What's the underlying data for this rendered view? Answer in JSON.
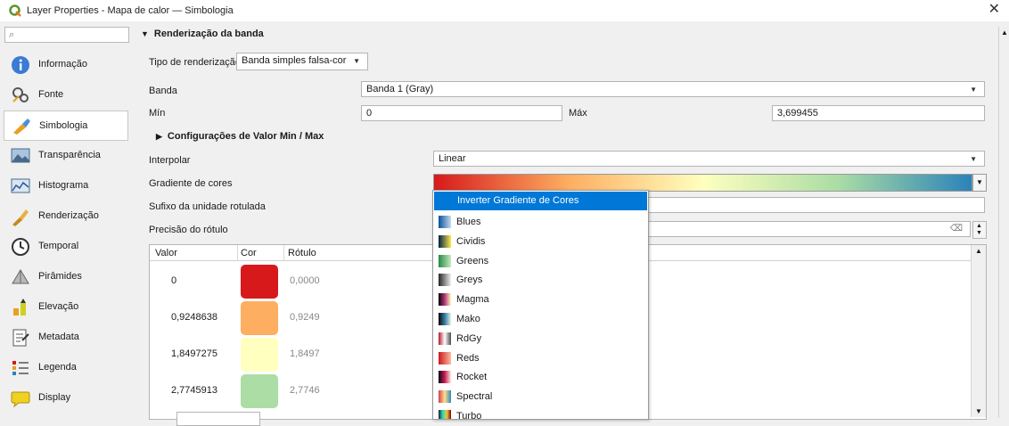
{
  "window": {
    "title": "Layer Properties - Mapa de calor — Simbologia",
    "close_glyph": "✕"
  },
  "sidebar": {
    "search_icon": "⌕",
    "items": [
      {
        "label": "Informação",
        "icon": "info-icon"
      },
      {
        "label": "Fonte",
        "icon": "source-icon"
      },
      {
        "label": "Simbologia",
        "icon": "symbology-icon",
        "active": true
      },
      {
        "label": "Transparência",
        "icon": "transparency-icon"
      },
      {
        "label": "Histograma",
        "icon": "histogram-icon"
      },
      {
        "label": "Renderização",
        "icon": "rendering-icon"
      },
      {
        "label": "Temporal",
        "icon": "clock-icon"
      },
      {
        "label": "Pirâmides",
        "icon": "pyramid-icon"
      },
      {
        "label": "Elevação",
        "icon": "elevation-icon"
      },
      {
        "label": "Metadata",
        "icon": "metadata-icon"
      },
      {
        "label": "Legenda",
        "icon": "legend-icon"
      },
      {
        "label": "Display",
        "icon": "display-icon"
      }
    ]
  },
  "render": {
    "section_title": "Renderização da banda",
    "tipo_label": "Tipo de renderização",
    "tipo_value": "Banda simples falsa-cor",
    "banda_label": "Banda",
    "banda_value": "Banda 1 (Gray)",
    "min_label": "Mín",
    "min_value": "0",
    "max_label": "Máx",
    "max_value": "3,699455",
    "minmax_section": "Configurações de Valor Min / Max",
    "interp_label": "Interpolar",
    "interp_value": "Linear",
    "gradient_label": "Gradiente de cores",
    "sufixo_label": "Sufixo da unidade rotulada",
    "precisao_label": "Precisão do rótulo"
  },
  "table": {
    "headers": [
      "Valor",
      "Cor",
      "Rótulo"
    ],
    "rows": [
      {
        "valor": "0",
        "rotulo": "0,0000",
        "color": "#d7191c"
      },
      {
        "valor": "0,9248638",
        "rotulo": "0,9249",
        "color": "#fdae61"
      },
      {
        "valor": "1,8497275",
        "rotulo": "1,8497",
        "color": "#ffffbf"
      },
      {
        "valor": "2,7745913",
        "rotulo": "2,7746",
        "color": "#abdda4"
      }
    ]
  },
  "popup": {
    "first": "Inverter Gradiente de Cores",
    "items": [
      {
        "label": "Blues",
        "colors": [
          "#08519c",
          "#c6dbef"
        ]
      },
      {
        "label": "Cividis",
        "colors": [
          "#00204c",
          "#ffe945"
        ]
      },
      {
        "label": "Greens",
        "colors": [
          "#238b45",
          "#c7e9c0"
        ]
      },
      {
        "label": "Greys",
        "colors": [
          "#252525",
          "#f0f0f0"
        ]
      },
      {
        "label": "Magma",
        "colors": [
          "#000004",
          "#b73779",
          "#fcfdbf"
        ]
      },
      {
        "label": "Mako",
        "colors": [
          "#0b0405",
          "#357ba2",
          "#def5e5"
        ]
      },
      {
        "label": "RdGy",
        "colors": [
          "#b2182b",
          "#ffffff",
          "#4d4d4d"
        ]
      },
      {
        "label": "Reds",
        "colors": [
          "#cb181d",
          "#fcbba1"
        ]
      },
      {
        "label": "Rocket",
        "colors": [
          "#03051a",
          "#cb1b4f",
          "#faebdd"
        ]
      },
      {
        "label": "Spectral",
        "colors": [
          "#d53e4f",
          "#fee08b",
          "#3288bd"
        ]
      },
      {
        "label": "Turbo",
        "colors": [
          "#30123b",
          "#1ae4b6",
          "#fabe3a",
          "#7a0403"
        ]
      }
    ]
  },
  "gradient_colors": [
    "#d7191c",
    "#fdae61",
    "#ffffbf",
    "#abdda4",
    "#2b83ba"
  ]
}
